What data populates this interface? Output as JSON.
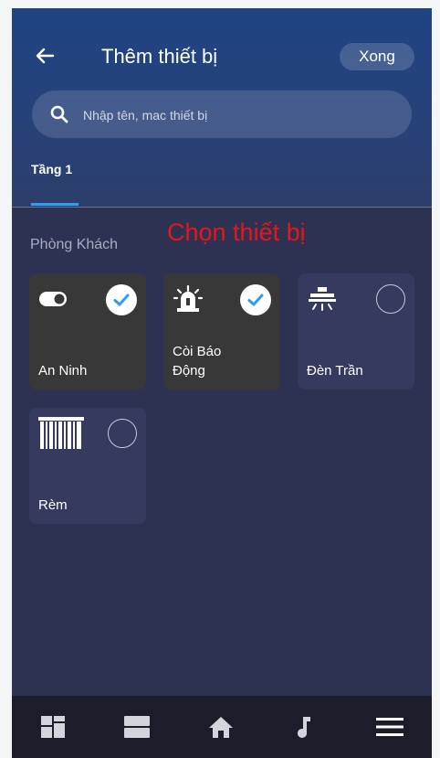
{
  "header": {
    "title": "Thêm thiết bị",
    "done_label": "Xong"
  },
  "search": {
    "placeholder": "Nhập tên, mac thiết bị"
  },
  "tabs": [
    {
      "label": "Tầng 1",
      "active": true
    }
  ],
  "room": {
    "name": "Phòng Khách",
    "hint": "Chọn thiết bị"
  },
  "devices": [
    {
      "label": "An Ninh",
      "icon": "toggle-icon",
      "selected": true
    },
    {
      "label": "Còi Báo\nĐộng",
      "icon": "siren-icon",
      "selected": true
    },
    {
      "label": "Đèn Trần",
      "icon": "ceiling-light-icon",
      "selected": false
    },
    {
      "label": "Rèm",
      "icon": "curtain-icon",
      "selected": false
    }
  ],
  "bottom_nav": [
    {
      "icon": "dashboard-icon"
    },
    {
      "icon": "rooms-icon"
    },
    {
      "icon": "home-icon"
    },
    {
      "icon": "music-icon"
    },
    {
      "icon": "menu-icon"
    }
  ],
  "colors": {
    "accent": "#2e9cf2",
    "hint_red": "#e8141b",
    "selected_card": "#383838",
    "unselected_card": "#353a5e"
  }
}
